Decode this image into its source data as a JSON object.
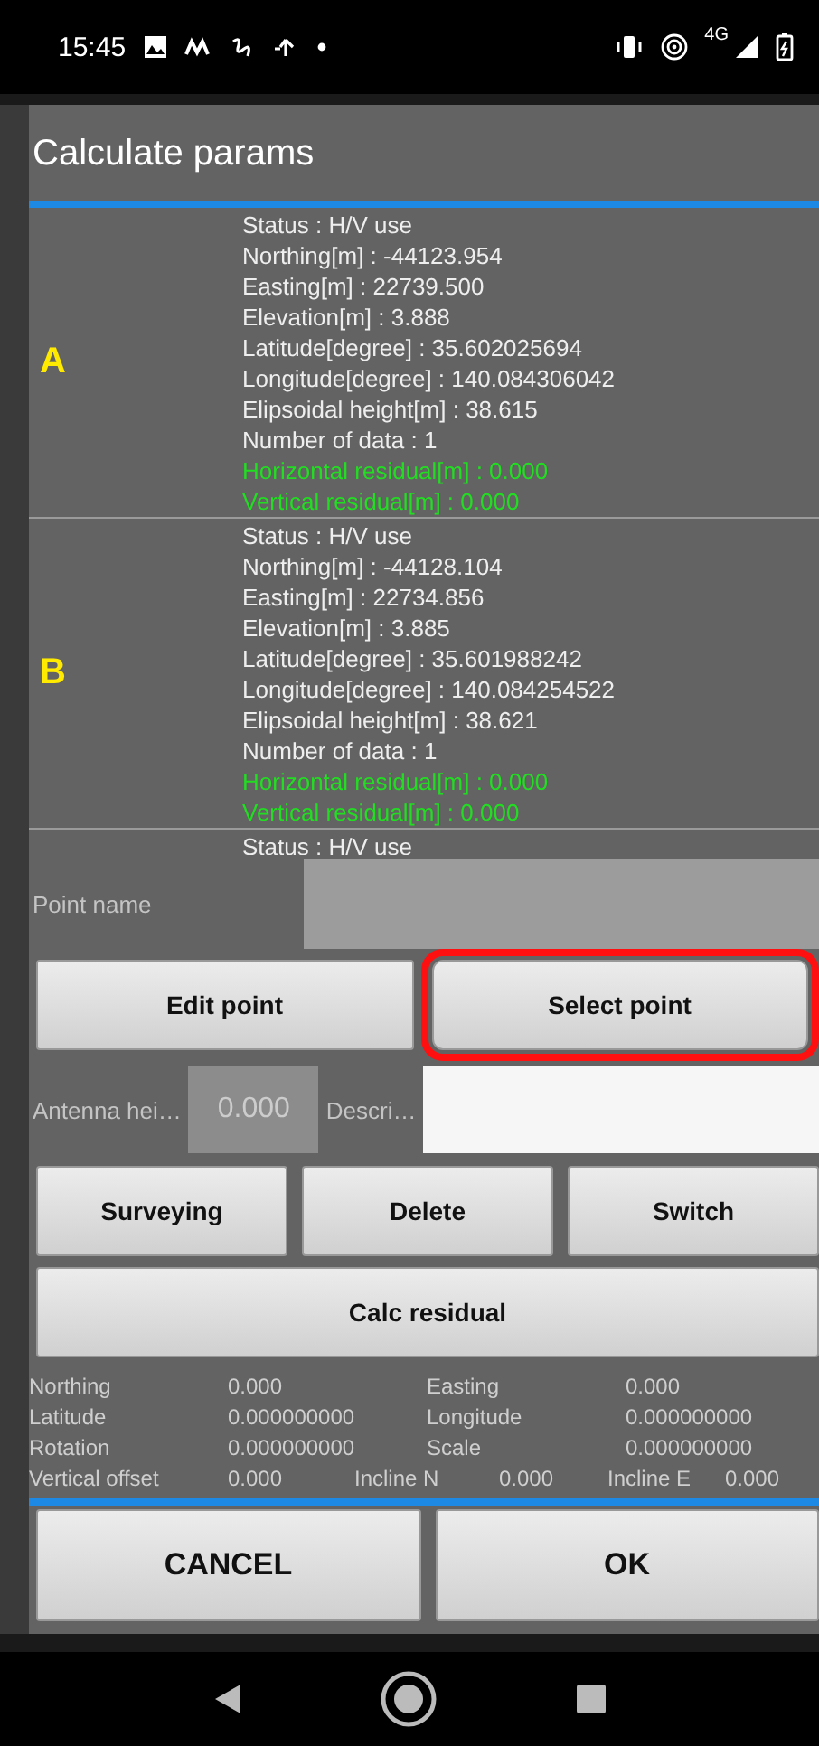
{
  "status_bar": {
    "time": "15:45",
    "network": "4G"
  },
  "dialog": {
    "title": "Calculate params",
    "points": [
      {
        "label": "A",
        "lines": [
          {
            "text": "Status : H/V use",
            "kind": "normal"
          },
          {
            "text": "Northing[m] : -44123.954",
            "kind": "normal"
          },
          {
            "text": "Easting[m] : 22739.500",
            "kind": "normal"
          },
          {
            "text": "Elevation[m] : 3.888",
            "kind": "normal"
          },
          {
            "text": "Latitude[degree] : 35.602025694",
            "kind": "normal"
          },
          {
            "text": "Longitude[degree] : 140.084306042",
            "kind": "normal"
          },
          {
            "text": "Elipsoidal height[m] : 38.615",
            "kind": "normal"
          },
          {
            "text": "Number of data : 1",
            "kind": "normal"
          },
          {
            "text": "Horizontal residual[m] : 0.000",
            "kind": "residual"
          },
          {
            "text": "Vertical residual[m] : 0.000",
            "kind": "residual"
          }
        ]
      },
      {
        "label": "B",
        "lines": [
          {
            "text": "Status : H/V use",
            "kind": "normal"
          },
          {
            "text": "Northing[m] : -44128.104",
            "kind": "normal"
          },
          {
            "text": "Easting[m] : 22734.856",
            "kind": "normal"
          },
          {
            "text": "Elevation[m] : 3.885",
            "kind": "normal"
          },
          {
            "text": "Latitude[degree] : 35.601988242",
            "kind": "normal"
          },
          {
            "text": "Longitude[degree] : 140.084254522",
            "kind": "normal"
          },
          {
            "text": "Elipsoidal height[m] : 38.621",
            "kind": "normal"
          },
          {
            "text": "Number of data : 1",
            "kind": "normal"
          },
          {
            "text": "Horizontal residual[m] : 0.000",
            "kind": "residual"
          },
          {
            "text": "Vertical residual[m] : 0.000",
            "kind": "residual"
          }
        ]
      },
      {
        "lines": [
          {
            "text": "Status : H/V use",
            "kind": "normal"
          }
        ]
      }
    ],
    "point_name": {
      "label": "Point name"
    },
    "point_buttons": [
      {
        "label": "Edit point",
        "highlighted": false
      },
      {
        "label": "Select point",
        "highlighted": true
      }
    ],
    "antenna": {
      "label": "Antenna hei…",
      "value": "0.000"
    },
    "description": {
      "label": "Descri…"
    },
    "action_buttons": [
      {
        "label": "Surveying"
      },
      {
        "label": "Delete"
      },
      {
        "label": "Switch"
      }
    ],
    "calc_button": {
      "label": "Calc residual"
    },
    "results": [
      {
        "cells": [
          {
            "label": "Northing",
            "value": "0.000"
          },
          {
            "label": "Easting",
            "value": "0.000"
          }
        ]
      },
      {
        "cells": [
          {
            "label": "Latitude",
            "value": "0.000000000"
          },
          {
            "label": "Longitude",
            "value": "0.000000000"
          }
        ]
      },
      {
        "cells": [
          {
            "label": "Rotation",
            "value": "0.000000000"
          },
          {
            "label": "Scale",
            "value": "0.000000000"
          }
        ]
      },
      {
        "cells": [
          {
            "label": "Vertical offset",
            "value": "0.000"
          },
          {
            "label": "Incline N",
            "value": "0.000"
          },
          {
            "label": "Incline E",
            "value": "0.000"
          }
        ]
      }
    ],
    "footer_buttons": [
      {
        "label": "CANCEL"
      },
      {
        "label": "OK"
      }
    ]
  }
}
